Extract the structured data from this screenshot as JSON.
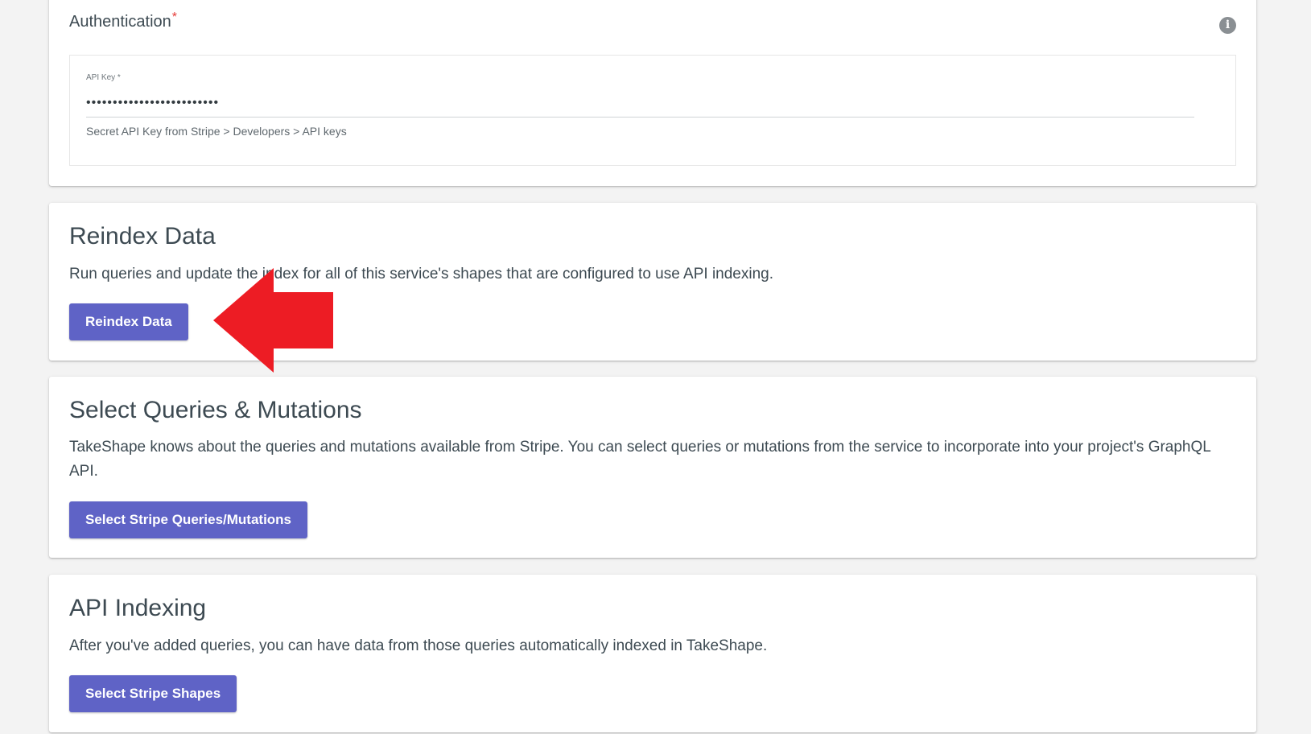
{
  "authentication": {
    "heading": "Authentication",
    "required_mark": "*",
    "info_icon": "info-icon",
    "info_glyph": "i",
    "api_key_label": "API Key *",
    "api_key_value": "•••••••••••••••••••••••••",
    "api_key_helper": "Secret API Key from Stripe > Developers > API keys"
  },
  "reindex": {
    "title": "Reindex Data",
    "description": "Run queries and update the index for all of this service's shapes that are configured to use API indexing.",
    "button_label": "Reindex Data"
  },
  "queries": {
    "title": "Select Queries & Mutations",
    "description": "TakeShape knows about the queries and mutations available from Stripe. You can select queries or mutations from the service to incorporate into your project's GraphQL API.",
    "button_label": "Select Stripe Queries/Mutations"
  },
  "indexing": {
    "title": "API Indexing",
    "description": "After you've added queries, you can have data from those queries automatically indexed in TakeShape.",
    "button_label": "Select Stripe Shapes"
  },
  "annotation": {
    "icon": "red-arrow-left-icon",
    "color": "#ed1c24"
  },
  "colors": {
    "accent": "#5f63c6",
    "background": "#f3f3f3",
    "card": "#ffffff",
    "required": "#e53935"
  }
}
